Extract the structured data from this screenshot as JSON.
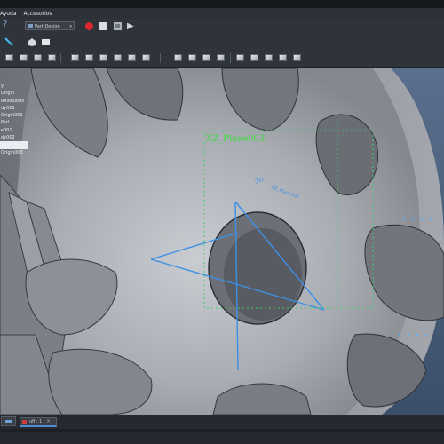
{
  "menu": {
    "items": [
      "Ayuda",
      "Accesorios"
    ]
  },
  "toolbar": {
    "help_glyph": "?",
    "workbench": "Part Design",
    "workbench_caret": "▾",
    "record_color": "#e0262d",
    "play_glyph": "▶"
  },
  "tree": {
    "items": [
      {
        "label": "y"
      },
      {
        "label": "Origin"
      },
      {
        "label": "Revolution"
      },
      {
        "label": "dy001"
      },
      {
        "label": "Origin001"
      },
      {
        "label": "Pad"
      },
      {
        "label": "e001"
      },
      {
        "label": "dy002"
      },
      {
        "label": ""
      },
      {
        "label": "Origin003"
      }
    ],
    "selected_index": 8
  },
  "viewport": {
    "plane_label": "XZ_Plane003",
    "sketch_label": "3D",
    "plane_label_small": "XZ_Plane003",
    "plane_label_color": "#3ddc3d",
    "axis_color": "#3c8fe6"
  },
  "bottom": {
    "doc_tab_label": "ufi : 1",
    "doc_tab_close": "×"
  }
}
